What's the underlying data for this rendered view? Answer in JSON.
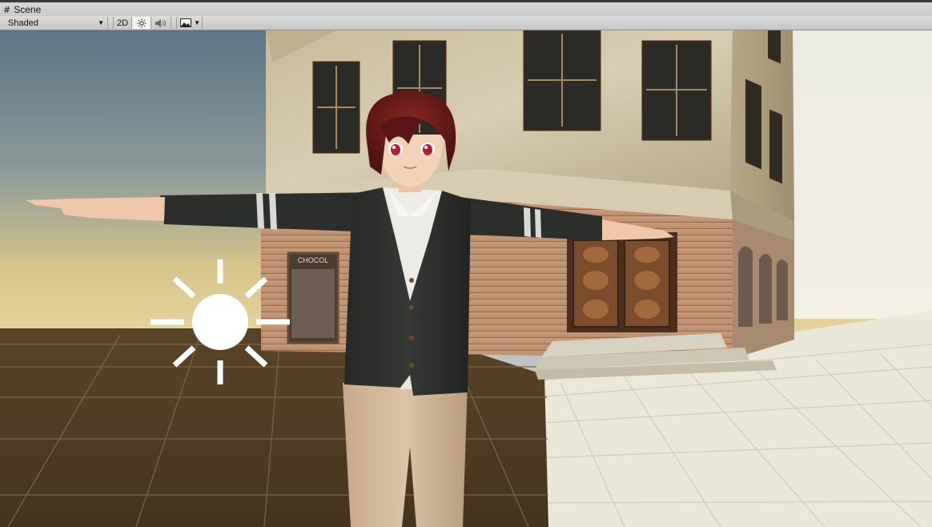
{
  "window": {
    "tab_title": "Scene",
    "tab_icon": "grid-icon"
  },
  "toolbar": {
    "draw_mode": "Shaded",
    "mode_2d_label": "2D",
    "lighting_icon": "sun-icon",
    "audio_icon": "speaker-icon",
    "effects_icon": "image-icon",
    "effects_dropdown_icon": "chevron-down-icon"
  },
  "scene": {
    "sign_text": "CHOCOL",
    "light_gizmo_icon": "directional-light-icon",
    "colors": {
      "sky_top": "#5a7284",
      "sky_horizon": "#d8c48a",
      "ground_dark": "#4b3a22",
      "ground_light": "#ece8d8",
      "cardigan": "#2c2e2c",
      "hair": "#6e1a16"
    }
  }
}
